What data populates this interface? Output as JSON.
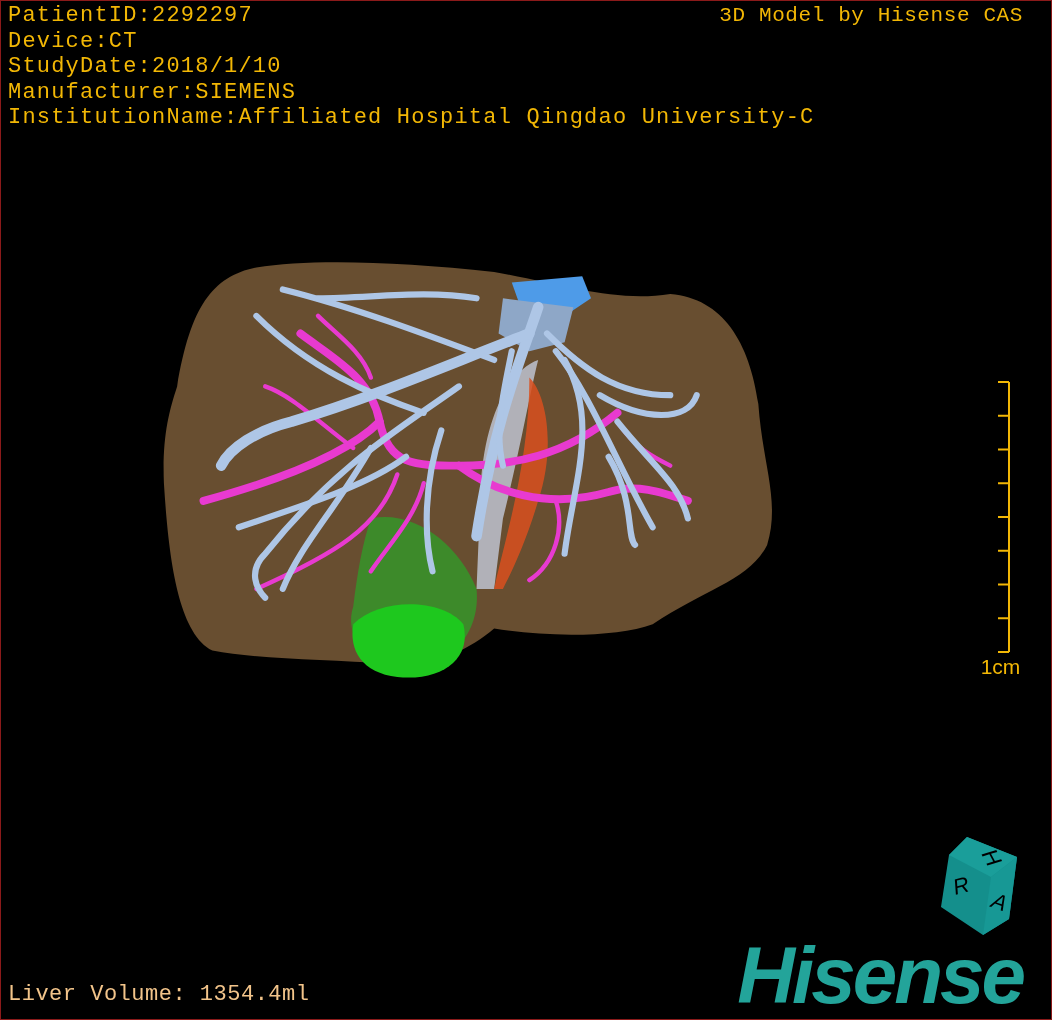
{
  "info_lines": [
    "PatientID:2292297",
    "Device:CT",
    "StudyDate:2018/1/10",
    "Manufacturer:SIEMENS",
    "InstitutionName:Affiliated Hospital Qingdao University-C"
  ],
  "title": "3D Model by Hisense CAS",
  "scale_bar": {
    "label": "1cm"
  },
  "orientation_cube": {
    "faces": [
      "H",
      "R",
      "A"
    ]
  },
  "volume": "Liver Volume: 1354.4ml",
  "logo": "Hisense"
}
